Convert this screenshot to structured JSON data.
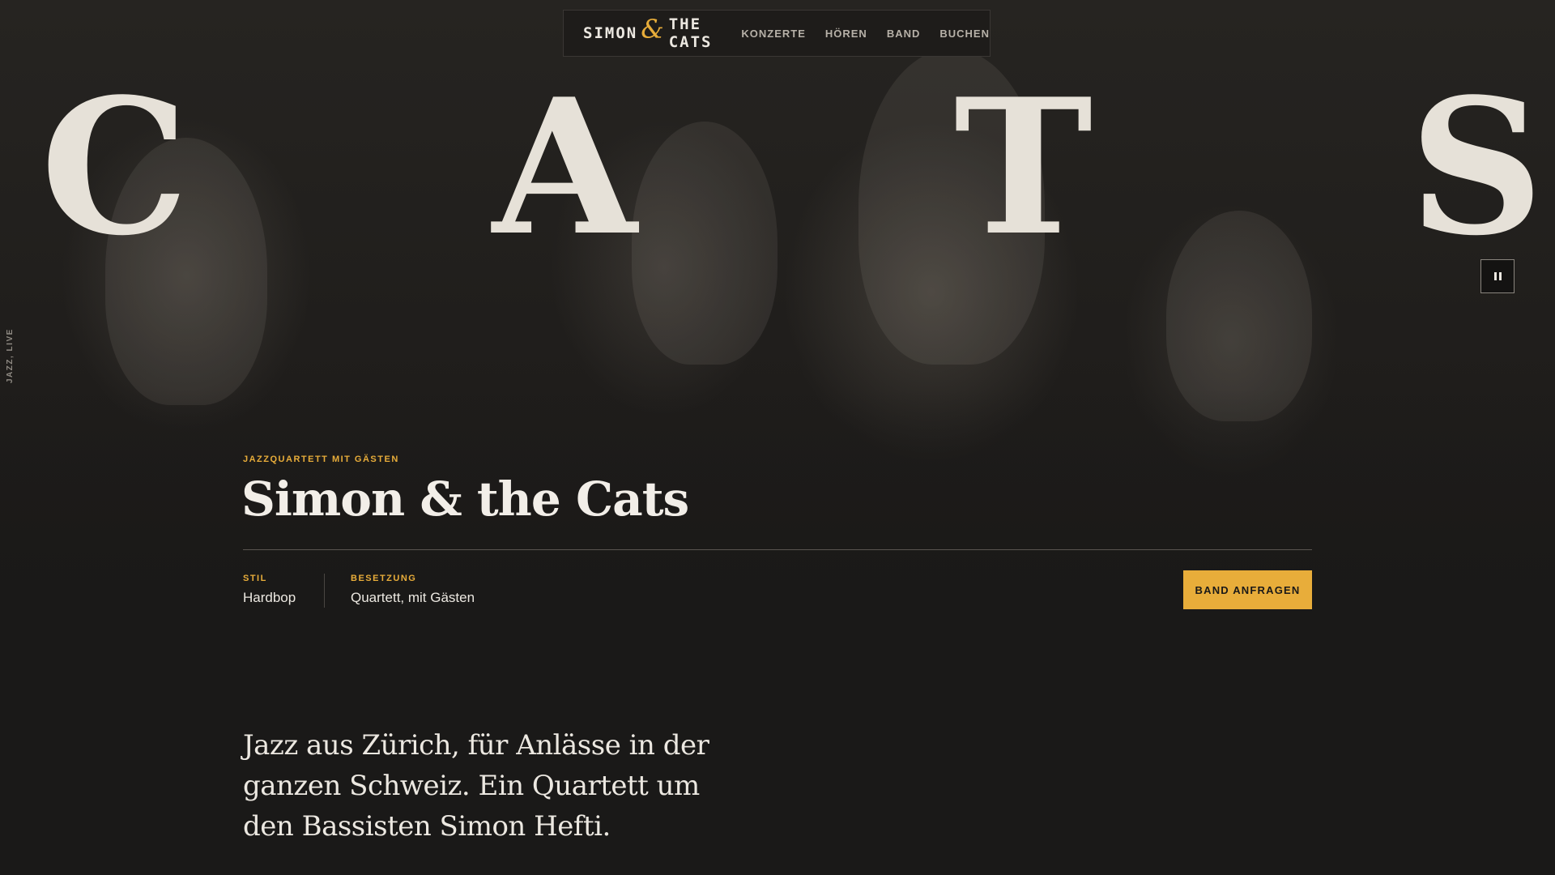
{
  "nav": {
    "logo_left": "SIMON",
    "logo_amp": "&",
    "logo_right": "THE CATS",
    "links": [
      "KONZERTE",
      "HÖREN",
      "BAND",
      "BUCHEN"
    ]
  },
  "hero": {
    "letters": [
      "C",
      "A",
      "T",
      "S"
    ],
    "side_label": "JAZZ, LIVE"
  },
  "band": {
    "eyebrow": "JAZZQUARTETT MIT GÄSTEN",
    "title": "Simon & the Cats",
    "meta": [
      {
        "label": "STIL",
        "value": "Hardbop"
      },
      {
        "label": "BESETZUNG",
        "value": "Quartett, mit Gästen"
      }
    ],
    "cta": "BAND ANFRAGEN"
  },
  "intro": "Jazz aus Zürich, für Anlässe in der ganzen Schweiz. Ein Quartett um den Bassisten Simon Hefti.",
  "colors": {
    "accent": "#e8ad3a",
    "background": "#1a1918",
    "text": "#ece8e1"
  },
  "icons": {
    "pause": "pause-icon"
  }
}
